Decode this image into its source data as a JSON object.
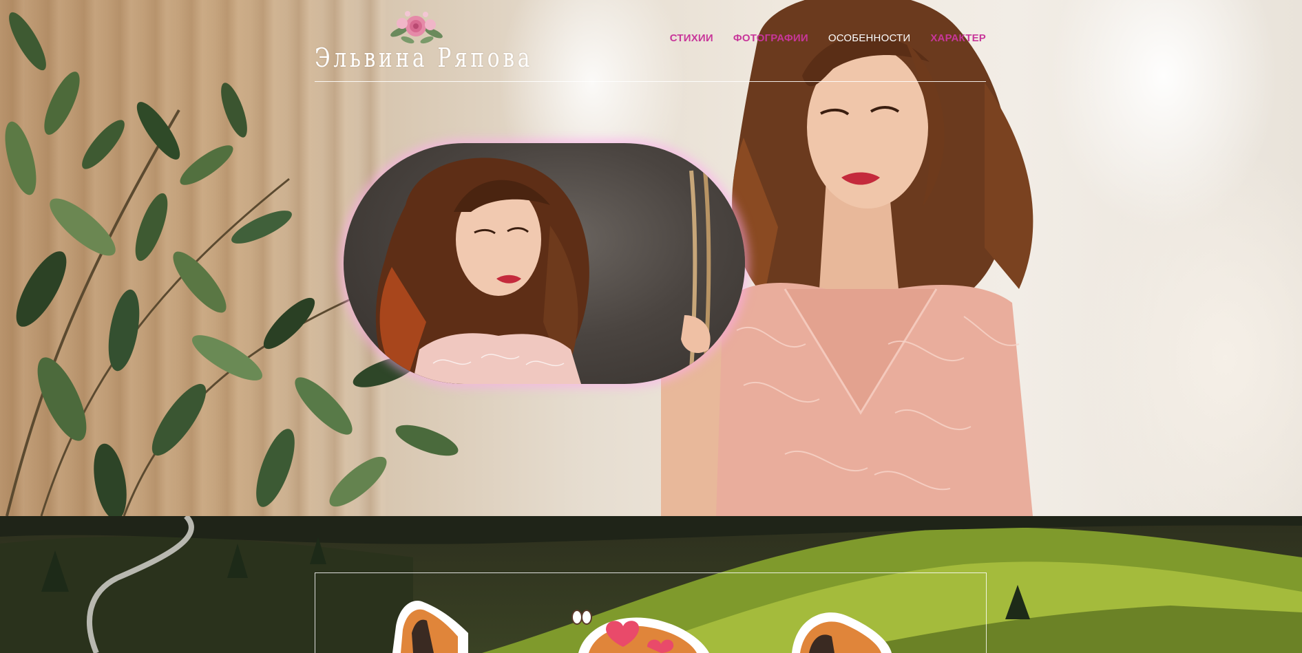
{
  "site": {
    "logo_text": "Эльвина Ряпова"
  },
  "nav": {
    "items": [
      {
        "label": "СТИХИИ",
        "color": "#c8369a"
      },
      {
        "label": "ФОТОГРАФИИ",
        "color": "#c8369a"
      },
      {
        "label": "ОСОБЕННОСТИ",
        "color": "#ffffff"
      },
      {
        "label": "ХАРАКТЕР",
        "color": "#c8369a"
      }
    ]
  },
  "colors": {
    "accent": "#c8369a",
    "divider": "#ffffff",
    "pill_glow": "#ffaaf0"
  },
  "icons": {
    "logo_flower": "pink-flower-bouquet",
    "stickers": [
      "fox-sticker",
      "fox-with-hearts-sticker",
      "fox-sticker"
    ]
  }
}
